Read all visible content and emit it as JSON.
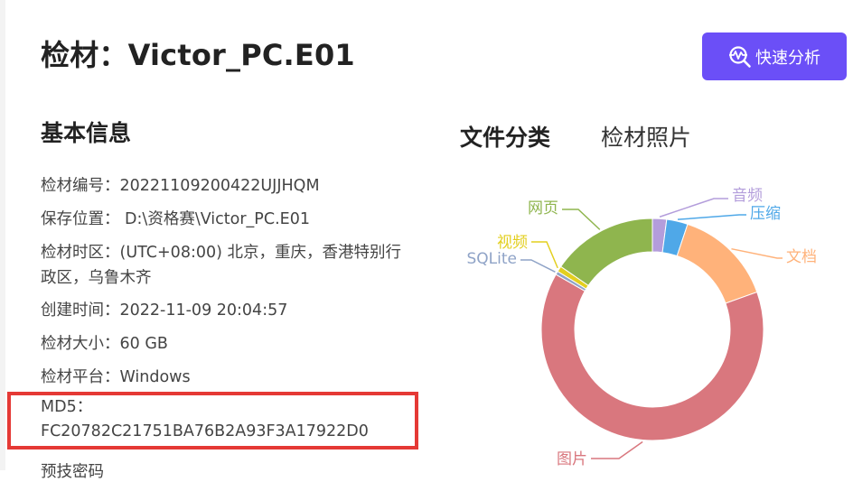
{
  "header": {
    "title": "检材：Victor_PC.E01",
    "quick_analysis_label": "快速分析",
    "quick_analysis_icon": "magnifier-pulse-icon"
  },
  "basic_info": {
    "section_title": "基本信息",
    "rows": [
      "检材编号：20221109200422UJJHQM",
      "保存位置：  D:\\资格赛\\Victor_PC.E01",
      "检材时区：(UTC+08:00) 北京，重庆，香港特别行政区，乌鲁木齐",
      "创建时间：2022-11-09 20:04:57",
      "检材大小：60 GB",
      "检材平台：Windows"
    ],
    "md5_label": "MD5：",
    "md5_value": "FC20782C21751BA76B2A93F3A17922D0",
    "cut_row": "预技密码"
  },
  "tabs": [
    {
      "label": "文件分类",
      "active": true
    },
    {
      "label": "检材照片",
      "active": false
    }
  ],
  "chart_data": {
    "type": "pie",
    "donut": true,
    "labels": [
      "音频",
      "压缩",
      "文档",
      "图片",
      "SQLite",
      "视频",
      "网页"
    ],
    "values": [
      2,
      3,
      14,
      62,
      0.5,
      0.8,
      15
    ],
    "colors": [
      "#b39ddb",
      "#4fa8e8",
      "#ffb27a",
      "#d9777e",
      "#8fa3c7",
      "#e3cf1f",
      "#8fb54e"
    ]
  }
}
